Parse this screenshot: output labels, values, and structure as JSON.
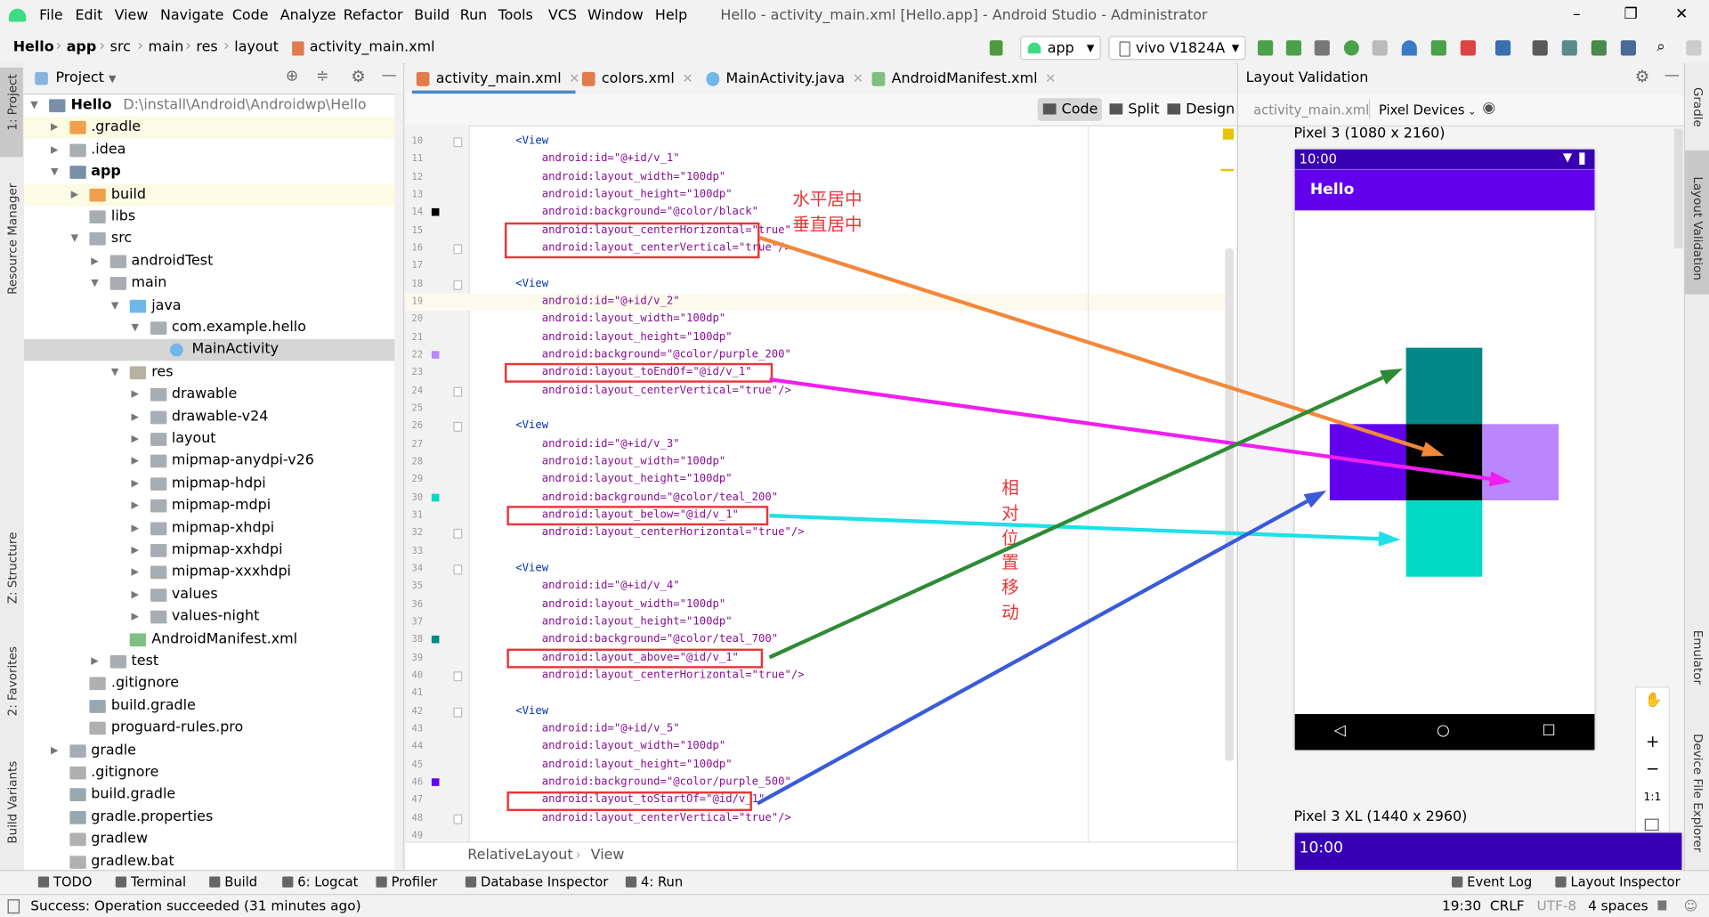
{
  "window": {
    "title": "Hello - activity_main.xml [Hello.app] - Android Studio - Administrator",
    "menu": [
      "File",
      "Edit",
      "View",
      "Navigate",
      "Code",
      "Analyze",
      "Refactor",
      "Build",
      "Run",
      "Tools",
      "VCS",
      "Window",
      "Help"
    ],
    "controls": {
      "minimize": "–",
      "maximize": "❐",
      "close": "✕"
    }
  },
  "breadcrumb": [
    "Hello",
    "app",
    "src",
    "main",
    "res",
    "layout",
    "activity_main.xml"
  ],
  "toolbar": {
    "run_config": "app",
    "device": "vivo V1824A"
  },
  "left_strip": [
    "1: Project",
    "Resource Manager",
    "Z: Structure",
    "2: Favorites",
    "Build Variants"
  ],
  "right_strip": [
    "Gradle",
    "Layout Validation",
    "Emulator",
    "Device File Explorer"
  ],
  "project": {
    "title": "Project",
    "tree": [
      {
        "label": "Hello",
        "path": "D:\\install\\Android\\Androidwp\\Hello",
        "level": 0,
        "state": "open",
        "icon": "module",
        "bold": true
      },
      {
        "label": ".gradle",
        "level": 1,
        "state": "closed",
        "icon": "folder-orange",
        "highlight": true
      },
      {
        "label": ".idea",
        "level": 1,
        "state": "closed",
        "icon": "folder"
      },
      {
        "label": "app",
        "level": 1,
        "state": "open",
        "icon": "module",
        "bold": true
      },
      {
        "label": "build",
        "level": 2,
        "state": "closed",
        "icon": "folder-orange",
        "highlight": true
      },
      {
        "label": "libs",
        "level": 2,
        "state": "none",
        "icon": "folder"
      },
      {
        "label": "src",
        "level": 2,
        "state": "open",
        "icon": "folder"
      },
      {
        "label": "androidTest",
        "level": 3,
        "state": "closed",
        "icon": "folder"
      },
      {
        "label": "main",
        "level": 3,
        "state": "open",
        "icon": "folder"
      },
      {
        "label": "java",
        "level": 4,
        "state": "open",
        "icon": "folder-blue"
      },
      {
        "label": "com.example.hello",
        "level": 5,
        "state": "open",
        "icon": "package"
      },
      {
        "label": "MainActivity",
        "level": 6,
        "state": "none",
        "icon": "class",
        "selected": true
      },
      {
        "label": "res",
        "level": 4,
        "state": "open",
        "icon": "folder-res"
      },
      {
        "label": "drawable",
        "level": 5,
        "state": "closed",
        "icon": "folder"
      },
      {
        "label": "drawable-v24",
        "level": 5,
        "state": "closed",
        "icon": "folder"
      },
      {
        "label": "layout",
        "level": 5,
        "state": "closed",
        "icon": "folder"
      },
      {
        "label": "mipmap-anydpi-v26",
        "level": 5,
        "state": "closed",
        "icon": "folder"
      },
      {
        "label": "mipmap-hdpi",
        "level": 5,
        "state": "closed",
        "icon": "folder"
      },
      {
        "label": "mipmap-mdpi",
        "level": 5,
        "state": "closed",
        "icon": "folder"
      },
      {
        "label": "mipmap-xhdpi",
        "level": 5,
        "state": "closed",
        "icon": "folder"
      },
      {
        "label": "mipmap-xxhdpi",
        "level": 5,
        "state": "closed",
        "icon": "folder"
      },
      {
        "label": "mipmap-xxxhdpi",
        "level": 5,
        "state": "closed",
        "icon": "folder"
      },
      {
        "label": "values",
        "level": 5,
        "state": "closed",
        "icon": "folder"
      },
      {
        "label": "values-night",
        "level": 5,
        "state": "closed",
        "icon": "folder"
      },
      {
        "label": "AndroidManifest.xml",
        "level": 4,
        "state": "none",
        "icon": "manifest"
      },
      {
        "label": "test",
        "level": 3,
        "state": "closed",
        "icon": "folder"
      },
      {
        "label": ".gitignore",
        "level": 2,
        "state": "none",
        "icon": "file"
      },
      {
        "label": "build.gradle",
        "level": 2,
        "state": "none",
        "icon": "gradle"
      },
      {
        "label": "proguard-rules.pro",
        "level": 2,
        "state": "none",
        "icon": "file"
      },
      {
        "label": "gradle",
        "level": 1,
        "state": "closed",
        "icon": "folder"
      },
      {
        "label": ".gitignore",
        "level": 1,
        "state": "none",
        "icon": "file"
      },
      {
        "label": "build.gradle",
        "level": 1,
        "state": "none",
        "icon": "gradle"
      },
      {
        "label": "gradle.properties",
        "level": 1,
        "state": "none",
        "icon": "gradle"
      },
      {
        "label": "gradlew",
        "level": 1,
        "state": "none",
        "icon": "file"
      },
      {
        "label": "gradlew.bat",
        "level": 1,
        "state": "none",
        "icon": "file"
      }
    ]
  },
  "editor": {
    "tabs": [
      {
        "label": "activity_main.xml",
        "icon": "xml",
        "active": true
      },
      {
        "label": "colors.xml",
        "icon": "xml"
      },
      {
        "label": "MainActivity.java",
        "icon": "class"
      },
      {
        "label": "AndroidManifest.xml",
        "icon": "manifest"
      }
    ],
    "modes": [
      "Code",
      "Split",
      "Design"
    ],
    "active_mode": "Code",
    "current_line": 19,
    "lines": [
      {
        "n": 10,
        "t": "    <View"
      },
      {
        "n": 11,
        "t": "        android:id=\"@+id/v_1\""
      },
      {
        "n": 12,
        "t": "        android:layout_width=\"100dp\""
      },
      {
        "n": 13,
        "t": "        android:layout_height=\"100dp\""
      },
      {
        "n": 14,
        "t": "        android:background=\"@color/black\"",
        "swatch": "#000000"
      },
      {
        "n": 15,
        "t": "        android:layout_centerHorizontal=\"true\""
      },
      {
        "n": 16,
        "t": "        android:layout_centerVertical=\"true\"/>"
      },
      {
        "n": 17,
        "t": ""
      },
      {
        "n": 18,
        "t": "    <View"
      },
      {
        "n": 19,
        "t": "        android:id=\"@+id/v_2\""
      },
      {
        "n": 20,
        "t": "        android:layout_width=\"100dp\""
      },
      {
        "n": 21,
        "t": "        android:layout_height=\"100dp\""
      },
      {
        "n": 22,
        "t": "        android:background=\"@color/purple_200\"",
        "swatch": "#bb86fc"
      },
      {
        "n": 23,
        "t": "        android:layout_toEndOf=\"@id/v_1\""
      },
      {
        "n": 24,
        "t": "        android:layout_centerVertical=\"true\"/>"
      },
      {
        "n": 25,
        "t": ""
      },
      {
        "n": 26,
        "t": "    <View"
      },
      {
        "n": 27,
        "t": "        android:id=\"@+id/v_3\""
      },
      {
        "n": 28,
        "t": "        android:layout_width=\"100dp\""
      },
      {
        "n": 29,
        "t": "        android:layout_height=\"100dp\""
      },
      {
        "n": 30,
        "t": "        android:background=\"@color/teal_200\"",
        "swatch": "#03dac5"
      },
      {
        "n": 31,
        "t": "        android:layout_below=\"@id/v_1\""
      },
      {
        "n": 32,
        "t": "        android:layout_centerHorizontal=\"true\"/>"
      },
      {
        "n": 33,
        "t": ""
      },
      {
        "n": 34,
        "t": "    <View"
      },
      {
        "n": 35,
        "t": "        android:id=\"@+id/v_4\""
      },
      {
        "n": 36,
        "t": "        android:layout_width=\"100dp\""
      },
      {
        "n": 37,
        "t": "        android:layout_height=\"100dp\""
      },
      {
        "n": 38,
        "t": "        android:background=\"@color/teal_700\"",
        "swatch": "#018786"
      },
      {
        "n": 39,
        "t": "        android:layout_above=\"@id/v_1\""
      },
      {
        "n": 40,
        "t": "        android:layout_centerHorizontal=\"true\"/>"
      },
      {
        "n": 41,
        "t": ""
      },
      {
        "n": 42,
        "t": "    <View"
      },
      {
        "n": 43,
        "t": "        android:id=\"@+id/v_5\""
      },
      {
        "n": 44,
        "t": "        android:layout_width=\"100dp\""
      },
      {
        "n": 45,
        "t": "        android:layout_height=\"100dp\""
      },
      {
        "n": 46,
        "t": "        android:background=\"@color/purple_500\"",
        "swatch": "#6200ee"
      },
      {
        "n": 47,
        "t": "        android:layout_toStartOf=\"@id/v_1\""
      },
      {
        "n": 48,
        "t": "        android:layout_centerVertical=\"true\"/>"
      },
      {
        "n": 49,
        "t": ""
      }
    ],
    "breadcrumb": [
      "RelativeLayout",
      "View"
    ]
  },
  "annotations": {
    "center_h": "水平居中",
    "center_v": "垂直居中",
    "relative": [
      "相",
      "对",
      "位",
      "置",
      "移",
      "动"
    ],
    "arrow_colors": {
      "center": "#f2883a",
      "to_end_of": "#f01ef0",
      "below": "#1ee0e6",
      "above": "#2e8b35",
      "to_start_of": "#3a5bd9"
    },
    "box_color": "#e8363a"
  },
  "layout_validation": {
    "title": "Layout Validation",
    "file": "activity_main.xml",
    "devices_dropdown": "Pixel Devices",
    "device1": {
      "label": "Pixel 3 (1080 x 2160)",
      "time": "10:00",
      "app_title": "Hello"
    },
    "device2": {
      "label": "Pixel 3 XL (1440 x 2960)",
      "time": "10:00"
    },
    "zoom_controls": [
      "+",
      "−",
      "1:1"
    ],
    "colors": {
      "statusbar": "#3700b3",
      "appbar": "#6200ee",
      "black": "#000000",
      "purple_200": "#bb86fc",
      "purple_500": "#6200ee",
      "teal_200": "#03dac5",
      "teal_700": "#018786"
    }
  },
  "bottom_tools": {
    "left": [
      "TODO",
      "Terminal",
      "Build",
      "6: Logcat",
      "Profiler",
      "Database Inspector",
      "4: Run"
    ],
    "right": [
      "Event Log",
      "Layout Inspector"
    ]
  },
  "status": {
    "message": "Success: Operation succeeded (31 minutes ago)",
    "position": "19:30",
    "line_sep": "CRLF",
    "encoding": "UTF-8",
    "indent": "4 spaces"
  }
}
